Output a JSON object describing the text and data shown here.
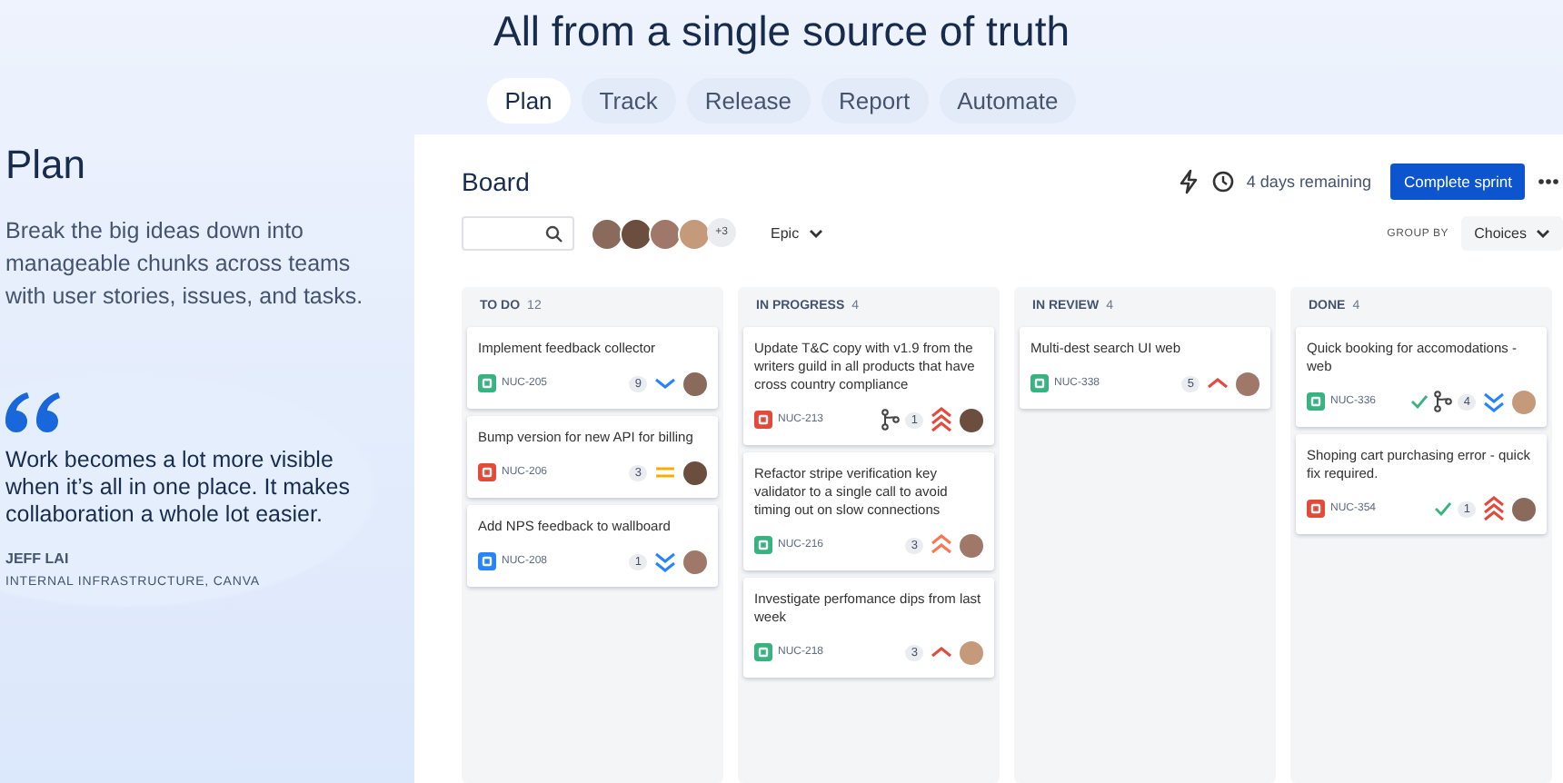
{
  "headline": "All from a single source of truth",
  "tabs": [
    {
      "label": "Plan",
      "selected": true
    },
    {
      "label": "Track",
      "selected": false
    },
    {
      "label": "Release",
      "selected": false
    },
    {
      "label": "Report",
      "selected": false
    },
    {
      "label": "Automate",
      "selected": false
    }
  ],
  "intro": {
    "title": "Plan",
    "text": "Break the big ideas down into manageable chunks across teams with user stories, issues, and tasks."
  },
  "quote": {
    "text": "Work becomes a lot more visible when it’s all in one place. It makes collaboration a whole lot easier.",
    "author": "JEFF LAI",
    "role": "INTERNAL INFRASTRUCTURE, CANVA"
  },
  "board": {
    "title": "Board",
    "remaining": "4 days remaining",
    "complete_button": "Complete sprint",
    "more_people": "+3",
    "epic_filter": "Epic",
    "group_by_label": "GROUP BY",
    "group_by_value": "Choices",
    "columns": [
      {
        "name": "TO DO",
        "count": "12",
        "cards": [
          {
            "title": "Implement feedback collector",
            "kind": "story",
            "key": "NUC-205",
            "branch": false,
            "done": false,
            "count": "9",
            "priority": {
              "kind": "low"
            }
          },
          {
            "title": "Bump version for new API for billing",
            "kind": "bug",
            "key": "NUC-206",
            "branch": false,
            "done": false,
            "count": "3",
            "priority": {
              "kind": "medium"
            }
          },
          {
            "title": "Add NPS feedback to wallboard",
            "kind": "task",
            "key": "NUC-208",
            "branch": false,
            "done": false,
            "count": "1",
            "priority": {
              "kind": "lowest"
            }
          }
        ]
      },
      {
        "name": "IN PROGRESS",
        "count": "4",
        "cards": [
          {
            "title": "Update T&C copy with v1.9 from the writers guild in all products that have cross country compliance",
            "kind": "bug",
            "key": "NUC-213",
            "branch": true,
            "done": false,
            "count": "1",
            "priority": {
              "kind": "highest"
            }
          },
          {
            "title": "Refactor stripe verification key validator to a single call to avoid timing out on slow connections",
            "kind": "story",
            "key": "NUC-216",
            "branch": false,
            "done": false,
            "count": "3",
            "priority": {
              "kind": "high"
            }
          },
          {
            "title": "Investigate perfomance dips from last week",
            "kind": "story",
            "key": "NUC-218",
            "branch": false,
            "done": false,
            "count": "3",
            "priority": {
              "kind": "major"
            }
          }
        ]
      },
      {
        "name": "IN REVIEW",
        "count": "4",
        "cards": [
          {
            "title": "Multi-dest search UI web",
            "kind": "story",
            "key": "NUC-338",
            "branch": false,
            "done": false,
            "count": "5",
            "priority": {
              "kind": "major"
            }
          }
        ]
      },
      {
        "name": "DONE",
        "count": "4",
        "cards": [
          {
            "title": "Quick booking for accomodations - web",
            "kind": "story",
            "key": "NUC-336",
            "branch": true,
            "done": true,
            "count": "4",
            "priority": {
              "kind": "lowest"
            }
          },
          {
            "title": "Shoping cart purchasing error - quick fix required.",
            "kind": "bug",
            "key": "NUC-354",
            "branch": false,
            "done": true,
            "count": "1",
            "priority": {
              "kind": "highest"
            }
          }
        ]
      }
    ]
  }
}
